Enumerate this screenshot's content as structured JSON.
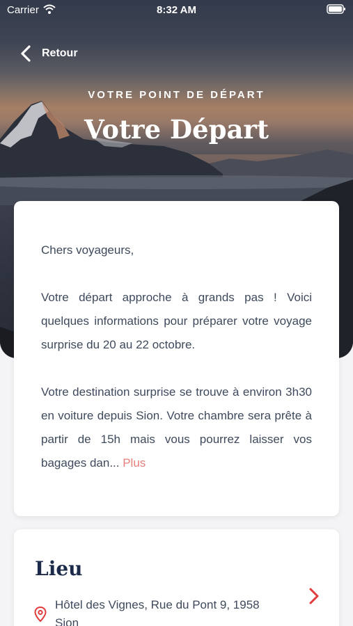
{
  "status_bar": {
    "carrier": "Carrier",
    "time": "8:32 AM"
  },
  "nav": {
    "back_label": "Retour"
  },
  "hero": {
    "eyebrow": "VOTRE POINT DE DÉPART",
    "title": "Votre Départ"
  },
  "intro": {
    "greeting": "Chers voyageurs,",
    "paragraph1": "Votre départ approche à grands pas ! Voici quelques informations pour préparer votre voyage surprise du 20 au 22 octobre.",
    "paragraph2": "Votre destination surprise se trouve à environ 3h30 en voiture depuis Sion. Votre chambre sera prête à partir de 15h mais vous pourrez laisser vos bagages dan...",
    "more_label": "Plus"
  },
  "location": {
    "title": "Lieu",
    "address": "Hôtel des Vignes, Rue du Pont 9, 1958 Sion"
  },
  "colors": {
    "accent": "#e23b3b",
    "more_link": "#e87f7a",
    "heading_navy": "#1c2b4a",
    "body_text": "#3e4a5c"
  },
  "icons": {
    "back": "chevron-left-icon",
    "wifi": "wifi-icon",
    "battery": "battery-icon",
    "pin": "map-pin-icon",
    "forward": "chevron-right-icon"
  }
}
